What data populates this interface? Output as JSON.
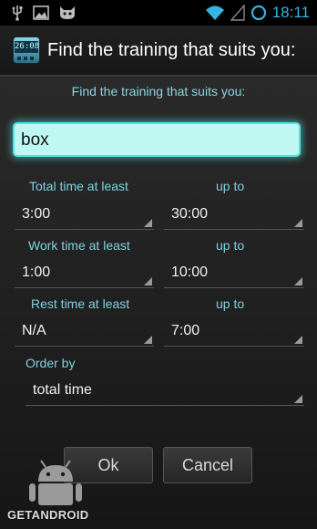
{
  "status": {
    "time": "18:11",
    "icons": [
      "usb-icon",
      "image-icon",
      "cat-icon",
      "wifi-icon",
      "signal-icon",
      "sync-icon"
    ]
  },
  "titlebar": {
    "app_icon_text": "26:08",
    "title": "Find the training that suits you:"
  },
  "dialog": {
    "heading": "Find the training that suits you:",
    "search_value": "box",
    "total": {
      "label": "Total time at least",
      "upto": "up to",
      "min": "3:00",
      "max": "30:00"
    },
    "work": {
      "label": "Work time at least",
      "upto": "up to",
      "min": "1:00",
      "max": "10:00"
    },
    "rest": {
      "label": "Rest time at least",
      "upto": "up to",
      "min": "N/A",
      "max": "7:00"
    },
    "order": {
      "label": "Order by",
      "value": "total time"
    },
    "ok_label": "Ok",
    "cancel_label": "Cancel"
  },
  "watermark": {
    "text": "GETANDROID",
    "icon": "android-robot-icon"
  },
  "colors": {
    "accent": "#33b5e5",
    "label": "#7fd1e0",
    "field": "#bff7f3"
  }
}
